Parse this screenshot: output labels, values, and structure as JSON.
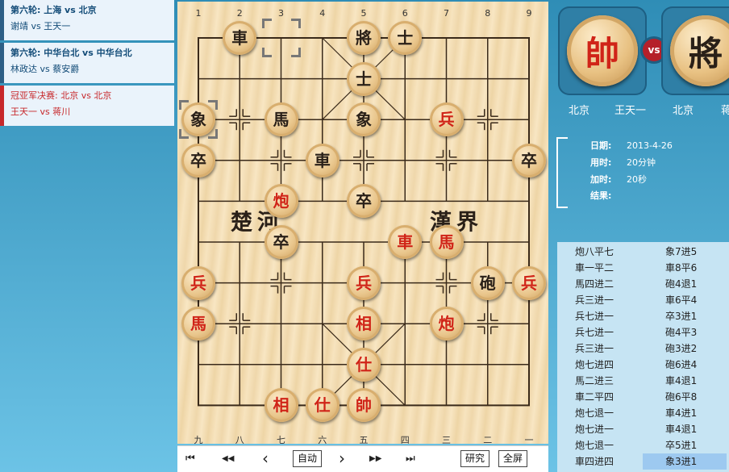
{
  "match_list": [
    {
      "title": "第六轮: 上海 vs 北京",
      "players": "谢靖 vs 王天一",
      "style": "blue"
    },
    {
      "title": "第六轮: 中华台北 vs 中华台北",
      "players": "林政达 vs 蔡安爵",
      "style": "blue"
    },
    {
      "title": "冠亚军决赛: 北京 vs 北京",
      "players": "王天一 vs 蒋川",
      "style": "red"
    }
  ],
  "board": {
    "top_numbers": [
      "1",
      "2",
      "3",
      "4",
      "5",
      "6",
      "7",
      "8",
      "9"
    ],
    "bottom_numbers": [
      "九",
      "八",
      "七",
      "六",
      "五",
      "四",
      "三",
      "二",
      "一"
    ],
    "river_left": "楚河",
    "river_right": "漢界",
    "pieces": [
      {
        "label": "車",
        "color": "b",
        "col": 1,
        "row": 0
      },
      {
        "label": "將",
        "color": "b",
        "col": 4,
        "row": 0
      },
      {
        "label": "士",
        "color": "b",
        "col": 5,
        "row": 0
      },
      {
        "label": "士",
        "color": "b",
        "col": 4,
        "row": 1
      },
      {
        "label": "象",
        "color": "b",
        "col": 0,
        "row": 2
      },
      {
        "label": "馬",
        "color": "b",
        "col": 2,
        "row": 2
      },
      {
        "label": "象",
        "color": "b",
        "col": 4,
        "row": 2
      },
      {
        "label": "兵",
        "color": "r",
        "col": 6,
        "row": 2
      },
      {
        "label": "卒",
        "color": "b",
        "col": 0,
        "row": 3
      },
      {
        "label": "車",
        "color": "b",
        "col": 3,
        "row": 3
      },
      {
        "label": "卒",
        "color": "b",
        "col": 8,
        "row": 3
      },
      {
        "label": "炮",
        "color": "r",
        "col": 2,
        "row": 4
      },
      {
        "label": "卒",
        "color": "b",
        "col": 4,
        "row": 4
      },
      {
        "label": "卒",
        "color": "b",
        "col": 2,
        "row": 5
      },
      {
        "label": "車",
        "color": "r",
        "col": 5,
        "row": 5
      },
      {
        "label": "馬",
        "color": "r",
        "col": 6,
        "row": 5
      },
      {
        "label": "兵",
        "color": "r",
        "col": 0,
        "row": 6
      },
      {
        "label": "兵",
        "color": "r",
        "col": 4,
        "row": 6
      },
      {
        "label": "砲",
        "color": "b",
        "col": 7,
        "row": 6
      },
      {
        "label": "兵",
        "color": "r",
        "col": 8,
        "row": 6
      },
      {
        "label": "馬",
        "color": "r",
        "col": 0,
        "row": 7
      },
      {
        "label": "相",
        "color": "r",
        "col": 4,
        "row": 7
      },
      {
        "label": "炮",
        "color": "r",
        "col": 6,
        "row": 7
      },
      {
        "label": "仕",
        "color": "r",
        "col": 4,
        "row": 8
      },
      {
        "label": "相",
        "color": "r",
        "col": 2,
        "row": 9
      },
      {
        "label": "仕",
        "color": "r",
        "col": 3,
        "row": 9
      },
      {
        "label": "帥",
        "color": "r",
        "col": 4,
        "row": 9
      }
    ],
    "selection_markers": [
      {
        "col": 2,
        "row": 0
      },
      {
        "col": 0,
        "row": 2
      }
    ]
  },
  "controls": {
    "first": "⏮",
    "prev_fast": "◀◀",
    "prev": "‹",
    "auto": "自动",
    "next": "›",
    "next_fast": "▶▶",
    "last": "⏭",
    "study": "研究",
    "fullscreen": "全屏"
  },
  "players": {
    "red_piece": "帥",
    "black_piece": "將",
    "vs": "vs",
    "red_team": "北京",
    "red_name": "王天一",
    "black_team": "北京",
    "black_name": "蒋"
  },
  "info": {
    "date_label": "日期:",
    "date": "2013-4-26",
    "time_used_label": "用时:",
    "time_used": "20分钟",
    "increment_label": "加时:",
    "increment": "20秒",
    "result_label": "结果:",
    "result": ""
  },
  "moves": [
    [
      "炮八平七",
      "象7进5"
    ],
    [
      "車一平二",
      "車8平6"
    ],
    [
      "馬四进二",
      "砲4退1"
    ],
    [
      "兵三进一",
      "車6平4"
    ],
    [
      "兵七进一",
      "卒3进1"
    ],
    [
      "兵七进一",
      "砲4平3"
    ],
    [
      "兵三进一",
      "砲3进2"
    ],
    [
      "炮七进四",
      "砲6进4"
    ],
    [
      "馬二进三",
      "車4退1"
    ],
    [
      "車二平四",
      "砲6平8"
    ],
    [
      "炮七退一",
      "車4进1"
    ],
    [
      "炮七进一",
      "車4退1"
    ],
    [
      "炮七退一",
      "卒5进1"
    ],
    [
      "車四进四",
      "象3进1"
    ]
  ],
  "highlighted_move": {
    "index": 13,
    "side": 1
  },
  "colors": {
    "red": "#d02418",
    "black": "#2a2018",
    "accent": "#2d5f86"
  }
}
